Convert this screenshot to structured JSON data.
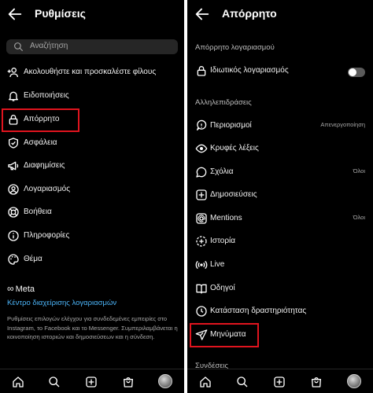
{
  "left": {
    "title": "Ρυθμίσεις",
    "search_placeholder": "Αναζήτηση",
    "items": [
      {
        "label": "Ακολουθήστε και προσκαλέστε φίλους",
        "icon": "add-person-icon"
      },
      {
        "label": "Ειδοποιήσεις",
        "icon": "bell-icon"
      },
      {
        "label": "Απόρρητο",
        "icon": "lock-icon"
      },
      {
        "label": "Ασφάλεια",
        "icon": "shield-icon"
      },
      {
        "label": "Διαφημίσεις",
        "icon": "megaphone-icon"
      },
      {
        "label": "Λογαριασμός",
        "icon": "account-icon"
      },
      {
        "label": "Βοήθεια",
        "icon": "lifebuoy-icon"
      },
      {
        "label": "Πληροφορίες",
        "icon": "info-icon"
      },
      {
        "label": "Θέμα",
        "icon": "palette-icon"
      }
    ],
    "meta_logo": "Meta",
    "meta_link": "Κέντρο διαχείρισης λογαριασμών",
    "meta_desc": "Ρυθμίσεις επιλογών ελέγχου για συνδεδεμένες εμπειρίες στο Instagram, το Facebook και το Messenger. Συμπεριλαμβάνεται η κοινοποίηση ιστοριών και δημοσιεύσεων και η σύνδεση."
  },
  "right": {
    "title": "Απόρρητο",
    "section_account": "Απόρρητο λογαριασμού",
    "private_account": "Ιδιωτικός λογαριασμός",
    "private_account_enabled": false,
    "section_interactions": "Αλληλεπιδράσεις",
    "items": [
      {
        "label": "Περιορισμοί",
        "value": "Απενεργοποίηση",
        "icon": "restrict-icon"
      },
      {
        "label": "Κρυφές λέξεις",
        "value": "",
        "icon": "hidden-words-icon"
      },
      {
        "label": "Σχόλια",
        "value": "Όλοι",
        "icon": "comment-icon"
      },
      {
        "label": "Δημοσιεύσεις",
        "value": "",
        "icon": "post-icon"
      },
      {
        "label": "Mentions",
        "value": "Όλοι",
        "icon": "at-icon"
      },
      {
        "label": "Ιστορία",
        "value": "",
        "icon": "story-icon"
      },
      {
        "label": "Live",
        "value": "",
        "icon": "live-icon"
      },
      {
        "label": "Οδηγοί",
        "value": "",
        "icon": "guide-icon"
      },
      {
        "label": "Κατάσταση δραστηριότητας",
        "value": "",
        "icon": "activity-icon"
      },
      {
        "label": "Μηνύματα",
        "value": "",
        "icon": "message-icon"
      }
    ],
    "section_connections": "Συνδέσεις"
  },
  "colors": {
    "background": "#000000",
    "highlight": "#e0141e",
    "link": "#4cb5f9"
  }
}
